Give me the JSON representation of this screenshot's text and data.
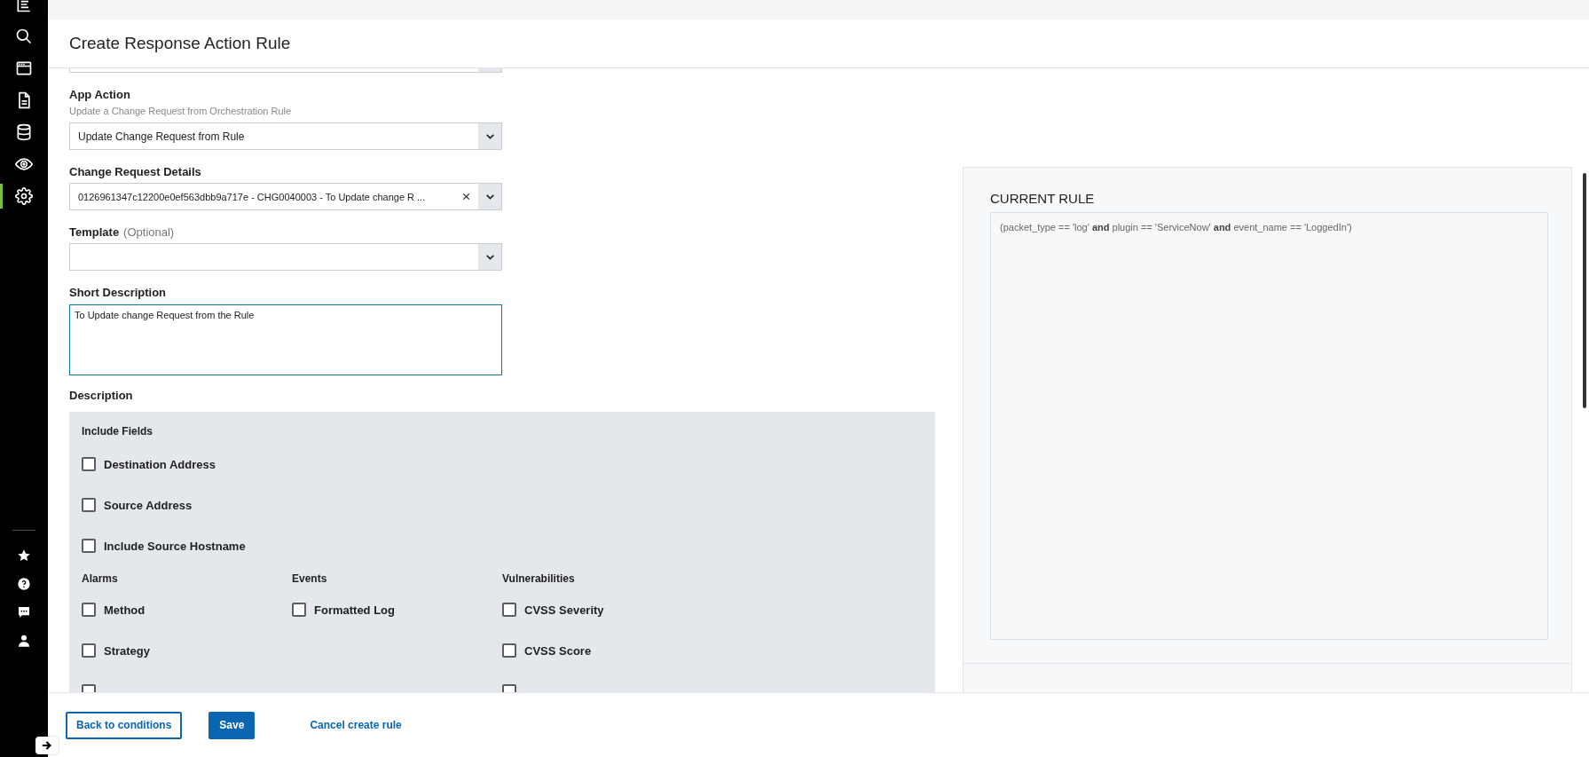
{
  "sidebar": {
    "items": [
      {
        "kind": "list",
        "selected": false
      },
      {
        "kind": "search",
        "selected": false
      },
      {
        "kind": "window",
        "selected": false
      },
      {
        "kind": "document",
        "selected": false
      },
      {
        "kind": "database",
        "selected": false
      },
      {
        "kind": "eye",
        "selected": false
      },
      {
        "kind": "gear",
        "selected": true
      }
    ],
    "bottom_items": [
      {
        "kind": "star"
      },
      {
        "kind": "help"
      },
      {
        "kind": "chat"
      },
      {
        "kind": "user"
      }
    ]
  },
  "header": {
    "title": "Create Response Action Rule"
  },
  "form": {
    "fields": [
      {
        "kind": "select"
      },
      {
        "kind": "select",
        "label": "App Action",
        "hint": "Update a Change Request from Orchestration Rule",
        "value": "Update Change Request from Rule"
      },
      {
        "kind": "select",
        "label": "Change Request Details",
        "value": "0126961347c12200e0ef563dbb9a717e - CHG0040003 - To Update change R ...",
        "clearable": true
      },
      {
        "kind": "select",
        "label": "Template",
        "optional": "(Optional)"
      },
      {
        "kind": "textarea",
        "label": "Short Description",
        "value": "To Update change Request from the Rule",
        "focused": true
      }
    ],
    "description": {
      "label": "Description",
      "include_fields": {
        "title": "Include Fields",
        "options": [
          {
            "label": "Destination Address",
            "checked": false
          },
          {
            "label": "Source Address",
            "checked": false
          },
          {
            "label": "Include Source Hostname",
            "checked": false
          }
        ]
      },
      "groups": [
        {
          "title": "Alarms",
          "options": [
            {
              "label": "Method",
              "checked": false
            },
            {
              "label": "Strategy",
              "checked": false
            },
            {
              "checked": false
            }
          ]
        },
        {
          "title": "Events",
          "options": [
            {
              "label": "Formatted Log",
              "checked": false
            }
          ]
        },
        {
          "title": "Vulnerabilities",
          "options": [
            {
              "label": "CVSS Severity",
              "checked": false
            },
            {
              "label": "CVSS Score",
              "checked": false
            },
            {
              "checked": false
            }
          ]
        }
      ]
    }
  },
  "current_rule": {
    "title": "CURRENT RULE",
    "rule": "(packet_type == 'log' **and** plugin == 'ServiceNow' **and** event_name == 'LoggedIn')"
  },
  "footer": {
    "buttons": [
      {
        "label": "Back to conditions",
        "kind": "outline"
      },
      {
        "label": "Save",
        "kind": "primary"
      },
      {
        "label": "Cancel create rule",
        "kind": "link"
      }
    ]
  }
}
